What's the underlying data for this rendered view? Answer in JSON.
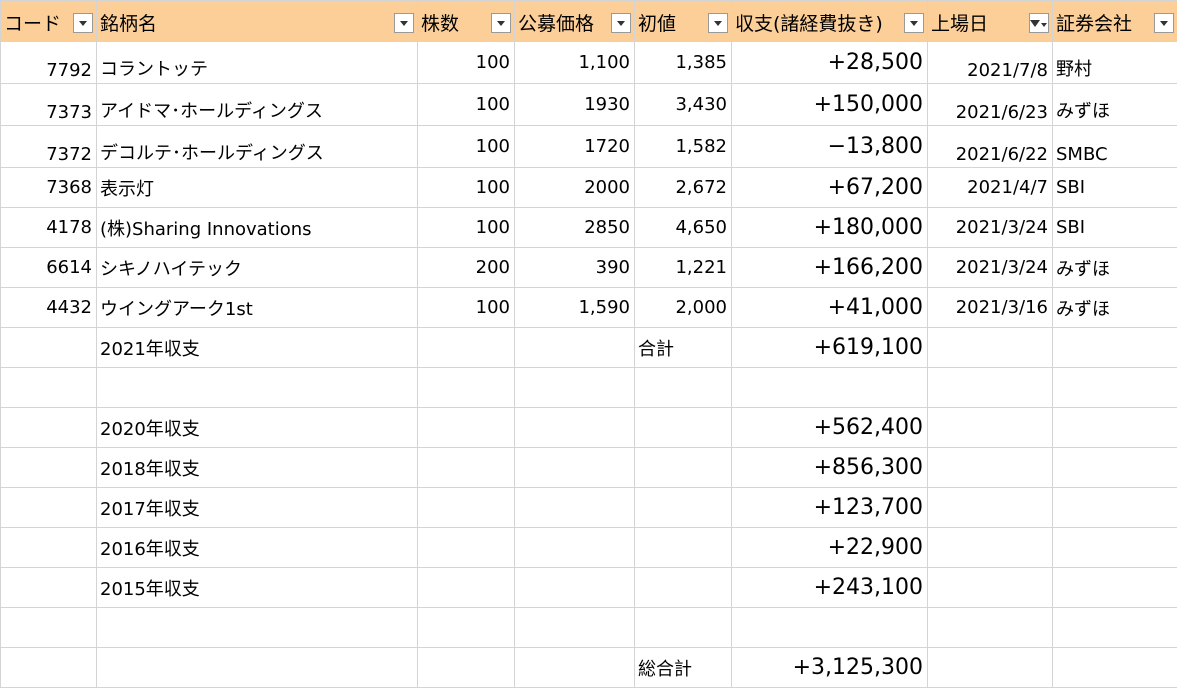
{
  "headers": {
    "code": "コード",
    "name": "銘柄名",
    "shares": "株数",
    "offer_price": "公募価格",
    "first_price": "初値",
    "profit": "収支(諸経費抜き)",
    "listing_date": "上場日",
    "broker": "証券会社"
  },
  "rows": [
    {
      "code": "7792",
      "name": "コラントッテ",
      "shares": "100",
      "offer": "1,100",
      "first": "1,385",
      "profit": "+28,500",
      "date": "2021/7/8",
      "broker": "野村"
    },
    {
      "code": "7373",
      "name": "アイドマ･ホールディングス",
      "shares": "100",
      "offer": "1930",
      "first": "3,430",
      "profit": "+150,000",
      "date": "2021/6/23",
      "broker": "みずほ"
    },
    {
      "code": "7372",
      "name": "デコルテ･ホールディングス",
      "shares": "100",
      "offer": "1720",
      "first": "1,582",
      "profit": "−13,800",
      "date": "2021/6/22",
      "broker": "SMBC"
    },
    {
      "code": "7368",
      "name": "表示灯",
      "shares": "100",
      "offer": "2000",
      "first": "2,672",
      "profit": "+67,200",
      "date": "2021/4/7",
      "broker": "SBI"
    },
    {
      "code": "4178",
      "name": "(株)Sharing Innovations",
      "shares": "100",
      "offer": "2850",
      "first": "4,650",
      "profit": "+180,000",
      "date": "2021/3/24",
      "broker": "SBI"
    },
    {
      "code": "6614",
      "name": "シキノハイテック",
      "shares": "200",
      "offer": "390",
      "first": "1,221",
      "profit": "+166,200",
      "date": "2021/3/24",
      "broker": "みずほ"
    },
    {
      "code": "4432",
      "name": "ウイングアーク1st",
      "shares": "100",
      "offer": "1,590",
      "first": "2,000",
      "profit": "+41,000",
      "date": "2021/3/16",
      "broker": "みずほ"
    }
  ],
  "subtotal": {
    "label": "2021年収支",
    "total_label": "合計",
    "value": "+619,100"
  },
  "past_years": [
    {
      "label": "2020年収支",
      "value": "+562,400"
    },
    {
      "label": "2018年収支",
      "value": "+856,300"
    },
    {
      "label": "2017年収支",
      "value": "+123,700"
    },
    {
      "label": "2016年収支",
      "value": "+22,900"
    },
    {
      "label": "2015年収支",
      "value": "+243,100"
    }
  ],
  "grand_total": {
    "label": "総合計",
    "value": "+3,125,300"
  },
  "icons": {
    "filter": "dropdown-arrow-icon",
    "active_filter": "filter-funnel-icon"
  },
  "colors": {
    "header_bg": "#fccf99",
    "grid": "#d4d4d4"
  }
}
